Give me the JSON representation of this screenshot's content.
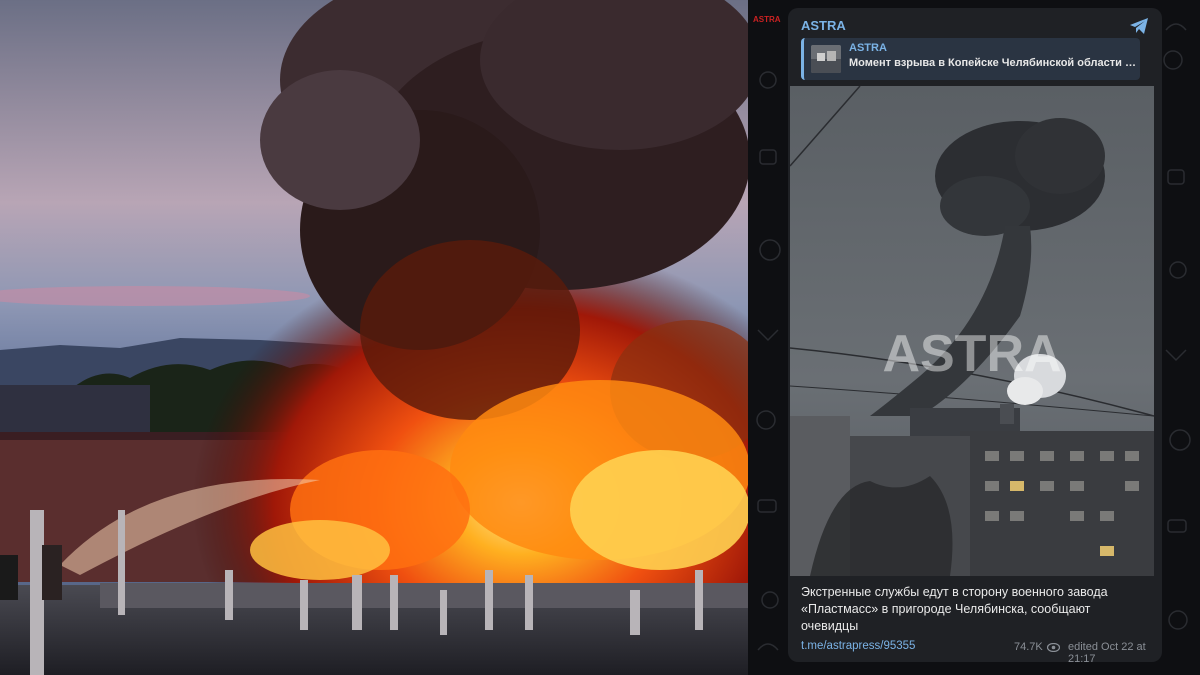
{
  "post": {
    "channel_name": "ASTRA",
    "forward": {
      "from": "ASTRA",
      "text": "Момент взрыва в Копейске Челябинской области П..."
    },
    "watermark": "ASTRA",
    "caption": "Экстренные службы едут в сторону военного завода «Пластмасс» в пригороде Челябинска, сообщают очевидцы",
    "link": "t.me/astrapress/95355",
    "views": "74.7K",
    "edited": "edited  Oct 22 at 21:17",
    "icons": [
      "share-icon",
      "eye-icon"
    ]
  },
  "corner_logo": "ASTRA",
  "colors": {
    "link": "#7bb3e6",
    "panel_bg": "#1f2125",
    "background": "#0e0f12"
  }
}
